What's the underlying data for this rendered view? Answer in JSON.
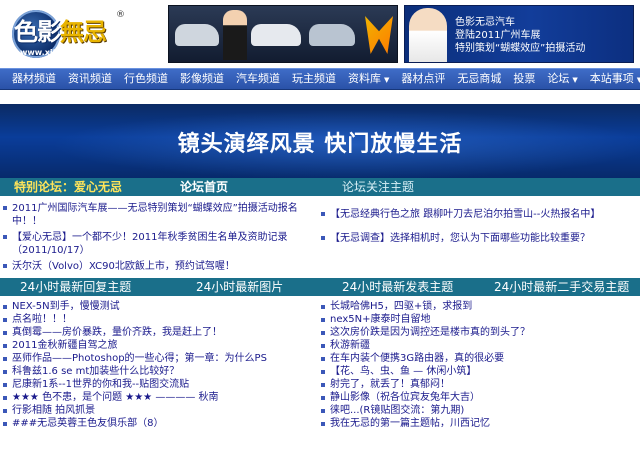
{
  "header": {
    "logo": {
      "text_a": "色影",
      "text_b": "無忌",
      "reg": "®",
      "url": "www.xitek.com"
    },
    "banner_right": {
      "line1": "色影无忌汽车",
      "line2": "登陆2011广州车展",
      "line3": "特别策划“蝴蝶效应”拍摄活动"
    }
  },
  "nav": {
    "items": [
      {
        "label": "器材频道"
      },
      {
        "label": "资讯频道"
      },
      {
        "label": "行色频道"
      },
      {
        "label": "影像频道"
      },
      {
        "label": "汽车频道"
      },
      {
        "label": "玩主频道"
      },
      {
        "label": "资料库",
        "caret": "▼"
      },
      {
        "label": "器材点评"
      },
      {
        "label": "无忌商城"
      },
      {
        "label": "投票"
      },
      {
        "label": "论坛",
        "caret": "▼"
      },
      {
        "label": "本站事项",
        "caret": "▼"
      }
    ]
  },
  "slogan": {
    "text": "镜头演绎风景 快门放慢生活"
  },
  "sections": {
    "special": "特别论坛：爱心无忌",
    "forum_home": "论坛首页",
    "focus": "论坛关注主题"
  },
  "top_left_items": [
    "2011广州国际汽车展——无忌特别策划“蝴蝶效应”拍摄活动报名中！！",
    "【爱心无忌】一个都不少！2011年秋季贫困生名单及资助记录（2011/10/17）",
    "沃尔沃（Volvo）XC90北欧飯上市，预约试驾喔！"
  ],
  "top_right_items": [
    "【无忌经典行色之旅 跟柳叶刀去尼泊尔拍雪山--火热报名中】",
    "【无忌调查】选择相机时，您认为下面哪些功能比较重要？"
  ],
  "h24": {
    "reply": "24小时最新回复主题",
    "images": "24小时最新图片",
    "posts": "24小时最新发表主题",
    "trade": "24小时最新二手交易主题"
  },
  "bottom_left_items": [
    "NEX-5N到手，慢慢测试",
    "点名啦！！！",
    "真倒霉——房价暴跌，量价齐跌，我是赶上了！",
    "2011金秋新疆自驾之旅",
    "巫师作品——Photoshop的一些心得；第一章：为什么PS",
    "科鲁兹1.6 se mt加装些什么比较好？",
    "尼康新1系--1世界的你和我--贴图交流贴",
    "★★★ 色不患，是个问题 ★★★ ———— 秋南",
    "行影相随 拍风抓景",
    "###无忌英蓉王色友俱乐部（8）"
  ],
  "bottom_right_items": [
    "长城哈佛H5，四驱+锁，求报到",
    "nex5N+康泰时自留地",
    "这次房价跌是因为调控还是楼市真的到头了？",
    "秋游新疆",
    "在车内装个便携3G路由器，真的很必要",
    "【花、鸟、虫、鱼 — 休闲小筑】",
    "射完了，就丢了！真郁闷！",
    "静山影像（祝各位宾友兔年大吉）",
    "徕吧...(R镜贴图交流：第九期)",
    "我在无忌的第一篇主题帖，川西记忆"
  ],
  "colors": {
    "nav_blue": "#2f5cb8",
    "section_teal": "#1a6f8a",
    "link_blue": "#1a1a8c",
    "special_yellow": "#ffe55a"
  }
}
